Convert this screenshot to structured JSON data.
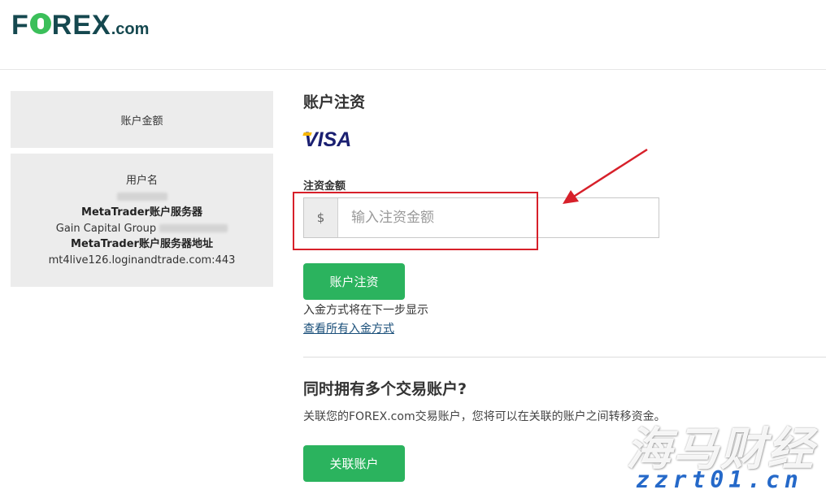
{
  "brand": {
    "logo_prefix": "F",
    "logo_suffix": "REX",
    "logo_domain": ".com",
    "brand_green": "#3bbf5a",
    "brand_dark": "#15484f"
  },
  "sidebar": {
    "balance_label": "账户金额",
    "username_label": "用户名",
    "server_label": "MetaTrader账户服务器",
    "server_value_prefix": "Gain Capital Group",
    "server_address_label": "MetaTrader账户服务器地址",
    "server_address_value": "mt4live126.loginandtrade.com:443"
  },
  "main": {
    "title": "账户注资",
    "payment_logo": "VISA",
    "amount_label": "注资金额",
    "currency_symbol": "$",
    "amount_placeholder": "输入注资金额",
    "amount_value": "",
    "deposit_button": "账户注资",
    "note": "入金方式将在下一步显示",
    "view_methods_link": "查看所有入金方式",
    "multi_title": "同时拥有多个交易账户?",
    "multi_desc": "关联您的FOREX.com交易账户，您将可以在关联的账户之间转移资金。",
    "link_button": "关联账户",
    "accent_color": "#2bb35e"
  },
  "annotation": {
    "highlight_color": "#d7202a"
  },
  "watermark": {
    "text": "海马财经",
    "url": "zzrt01.cn"
  }
}
